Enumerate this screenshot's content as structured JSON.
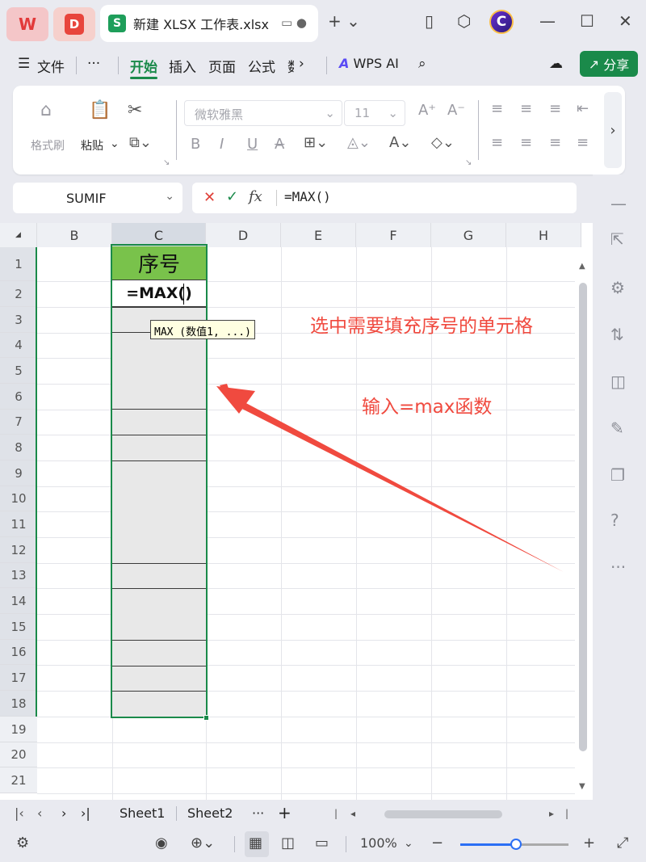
{
  "titlebar": {
    "app_logo": "W",
    "pdf_logo": "D",
    "tab_title": "新建 XLSX 工作表.xlsx",
    "avatar_letter": "C"
  },
  "menubar": {
    "items": [
      "文件",
      "···",
      "开始",
      "插入",
      "页面",
      "公式",
      "数"
    ],
    "active": "开始",
    "wps_ai": "WPS AI",
    "share": "分享"
  },
  "ribbon": {
    "format_painter": "格式刷",
    "paste": "粘贴",
    "font_name": "微软雅黑",
    "font_size": "11"
  },
  "formula_bar": {
    "name_box": "SUMIF",
    "formula": "=MAX()"
  },
  "grid": {
    "columns": [
      "B",
      "C",
      "D",
      "E",
      "F",
      "G",
      "H"
    ],
    "selected_column": "C",
    "rows": [
      "1",
      "2",
      "3",
      "4",
      "5",
      "6",
      "7",
      "8",
      "9",
      "10",
      "11",
      "12",
      "13",
      "14",
      "15",
      "16",
      "17",
      "18",
      "19",
      "20",
      "21"
    ],
    "header_cell": "序号",
    "edit_cell": "=MAX()",
    "tooltip": "MAX (数值1, ...)",
    "header_fill_color": "#79c24b",
    "selection_color": "#1a8a4a"
  },
  "annotations": {
    "note1": "选中需要填充序号的单元格",
    "note2": "输入=max函数",
    "color": "#f04a3f"
  },
  "sheets": [
    "Sheet1",
    "Sheet2"
  ],
  "statusbar": {
    "zoom": "100%",
    "zoom_fraction": 0.5
  }
}
